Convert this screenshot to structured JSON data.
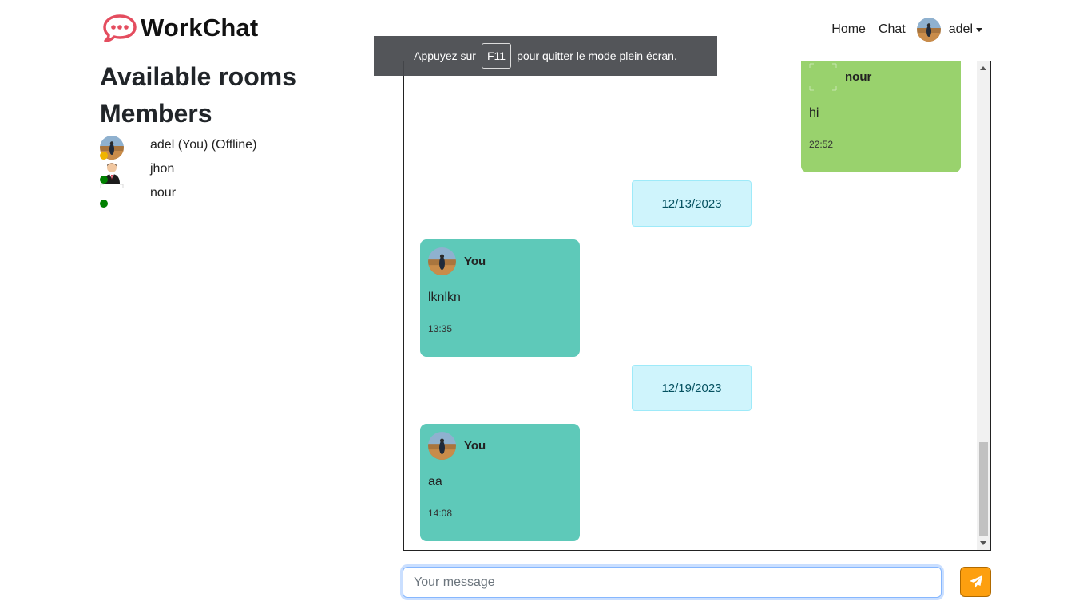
{
  "brand": {
    "name": "WorkChat",
    "accent": "#e44d5f"
  },
  "nav": {
    "home": "Home",
    "chat": "Chat",
    "user": "adel"
  },
  "sidebar": {
    "rooms_heading": "Available rooms",
    "members_heading": "Members",
    "members": [
      {
        "name": "adel (You) (Offline)",
        "status_color": "#f0b400",
        "avatar": "photo-avatar"
      },
      {
        "name": "jhon",
        "status_color": "#008000",
        "avatar": "person-avatar"
      },
      {
        "name": "nour",
        "status_color": "#008000",
        "avatar": "broken-avatar"
      }
    ]
  },
  "chat": {
    "messages": [
      {
        "sender": "nour",
        "text": "hi",
        "time": "22:52",
        "color": "#99d26d"
      },
      {
        "sender": "You",
        "text": "lknlkn",
        "time": "13:35",
        "color": "#5ec9b9"
      },
      {
        "sender": "You",
        "text": "aa",
        "time": "14:08",
        "color": "#5ec9b9"
      }
    ],
    "dates": [
      "12/13/2023",
      "12/19/2023"
    ]
  },
  "fullscreen_notice": {
    "before": "Appuyez sur",
    "key": "F11",
    "after": "pour quitter le mode plein écran."
  },
  "composer": {
    "placeholder": "Your message",
    "value": "",
    "send_icon": "paper-plane-icon",
    "send_color": "#fd9f0f"
  }
}
